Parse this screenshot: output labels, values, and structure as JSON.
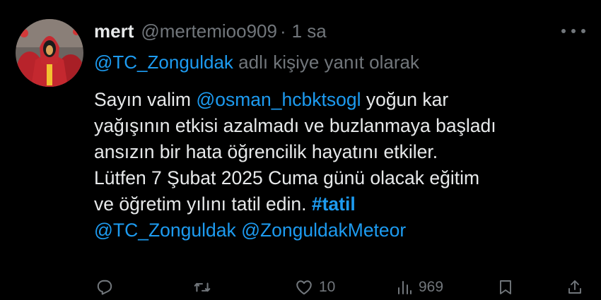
{
  "tweet": {
    "author_name": "mert",
    "author_handle": "@mertemioo909",
    "separator": "·",
    "time": "1 sa",
    "reply_prefix_mention": "@TC_Zonguldak",
    "reply_suffix": " adlı kişiye yanıt olarak",
    "body": {
      "line1_pre": "Sayın valim ",
      "line1_mention": "@osman_hcbktsogl",
      "line1_post": " yoğun kar",
      "line2": "yağışının etkisi azalmadı ve buzlanmaya başladı",
      "line3": "ansızın bir hata öğrencilik hayatını etkiler.",
      "line4": "Lütfen 7 Şubat 2025 Cuma günü olacak eğitim",
      "line5_pre": "ve öğretim yılını tatil edin. ",
      "line5_hashtag": "#tatil",
      "line6_mention1": "@TC_Zonguldak",
      "line6_space": " ",
      "line6_mention2": "@ZonguldakMeteor"
    },
    "actions": {
      "reply_icon": "reply-icon",
      "retweet_icon": "retweet-icon",
      "like_icon": "heart-icon",
      "like_count": "10",
      "views_icon": "views-icon",
      "views_count": "969",
      "bookmark_icon": "bookmark-icon",
      "share_icon": "share-icon"
    }
  },
  "colors": {
    "background": "#000000",
    "text": "#e7e9ea",
    "muted": "#71767b",
    "link": "#1d9bf0"
  }
}
